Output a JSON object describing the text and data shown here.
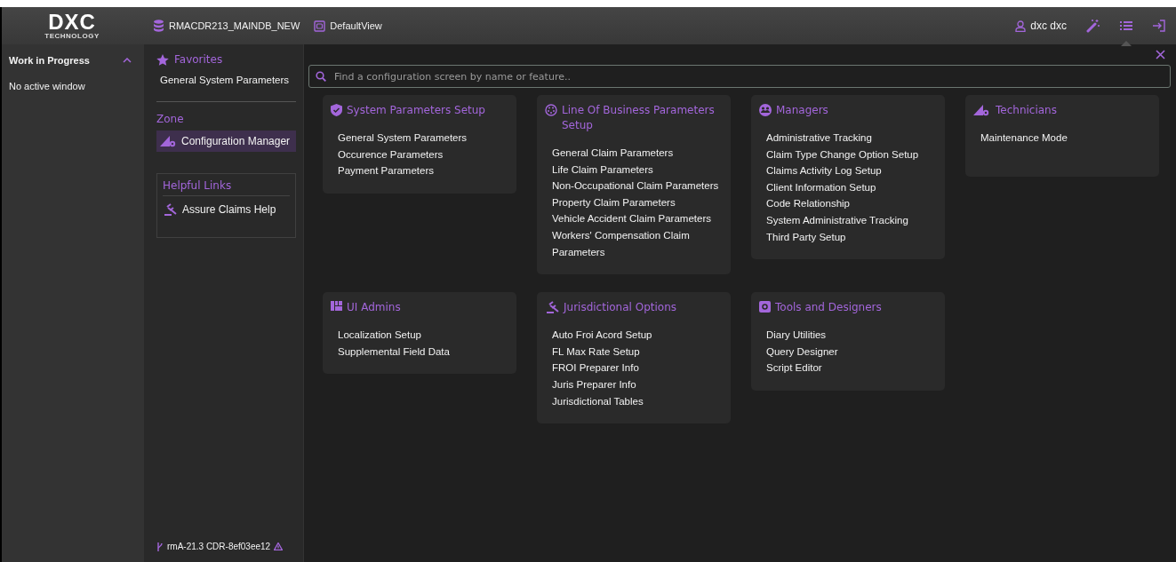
{
  "header": {
    "logo": {
      "mark": "DXC",
      "sub": "TECHNOLOGY"
    },
    "database": "RMACDR213_MAINDB_NEW",
    "view": "DefaultView",
    "user": "dxc dxc"
  },
  "work_in_progress": {
    "title": "Work in Progress",
    "expanded": true,
    "empty_text": "No active window"
  },
  "favorites": {
    "title": "Favorites",
    "items": [
      "General System Parameters"
    ]
  },
  "zone": {
    "title": "Zone",
    "items": [
      {
        "label": "Configuration Manager",
        "selected": true
      }
    ]
  },
  "helpful_links": {
    "title": "Helpful Links",
    "items": [
      "Assure Claims Help"
    ]
  },
  "version": "rmA-21.3 CDR-8ef03ee12",
  "search": {
    "placeholder": "Find a configuration screen by name or feature.."
  },
  "cards": [
    {
      "title": "System Parameters Setup",
      "items": [
        "General System Parameters",
        "Occurence Parameters",
        "Payment Parameters"
      ]
    },
    {
      "title": "Line Of Business Parameters Setup",
      "items": [
        "General Claim Parameters",
        "Life Claim Parameters",
        "Non-Occupational Claim Parameters",
        "Property Claim Parameters",
        "Vehicle Accident Claim Parameters",
        "Workers' Compensation Claim Parameters"
      ]
    },
    {
      "title": "Managers",
      "items": [
        "Administrative Tracking",
        "Claim Type Change Option Setup",
        "Claims Activity Log Setup",
        "Client Information Setup",
        "Code Relationship",
        "System Administrative Tracking",
        "Third Party Setup"
      ]
    },
    {
      "title": "Technicians",
      "items": [
        "Maintenance Mode"
      ]
    },
    {
      "title": "UI Admins",
      "items": [
        "Localization Setup",
        "Supplemental Field Data"
      ]
    },
    {
      "title": "Jurisdictional Options",
      "items": [
        "Auto Froi Acord Setup",
        "FL Max Rate Setup",
        "FROI Preparer Info",
        "Juris Preparer Info",
        "Jurisdictional Tables"
      ]
    },
    {
      "title": "Tools and Designers",
      "items": [
        "Diary Utilities",
        "Query Designer",
        "Script Editor"
      ]
    }
  ]
}
